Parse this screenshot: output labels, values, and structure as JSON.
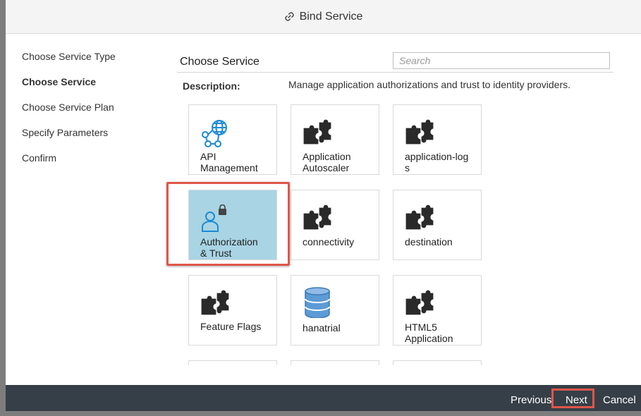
{
  "dialog": {
    "title": "Bind Service",
    "title_icon": "link-icon"
  },
  "steps": [
    {
      "label": "Choose Service Type",
      "active": false
    },
    {
      "label": "Choose Service",
      "active": true
    },
    {
      "label": "Choose Service Plan",
      "active": false
    },
    {
      "label": "Specify Parameters",
      "active": false
    },
    {
      "label": "Confirm",
      "active": false
    }
  ],
  "content": {
    "title": "Choose Service",
    "search": {
      "placeholder": "Search",
      "value": ""
    },
    "description_label": "Description:",
    "description_text": "Manage application authorizations and trust to identity providers."
  },
  "services": [
    {
      "label_lines": [
        "API",
        "Management"
      ],
      "icon": "api-management-icon",
      "selected": false
    },
    {
      "label_lines": [
        "Application",
        "Autoscaler"
      ],
      "icon": "puzzle-icon",
      "selected": false
    },
    {
      "label_lines": [
        "application-log",
        "s"
      ],
      "icon": "puzzle-icon",
      "selected": false
    },
    {
      "label_lines": [
        "Authorization",
        "& Trust"
      ],
      "icon": "user-lock-icon",
      "selected": true
    },
    {
      "label_lines": [
        "connectivity"
      ],
      "icon": "puzzle-icon",
      "selected": false
    },
    {
      "label_lines": [
        "destination"
      ],
      "icon": "puzzle-icon",
      "selected": false
    },
    {
      "label_lines": [
        "Feature Flags"
      ],
      "icon": "puzzle-icon",
      "selected": false
    },
    {
      "label_lines": [
        "hanatrial"
      ],
      "icon": "database-icon",
      "selected": false
    },
    {
      "label_lines": [
        "HTML5",
        "Application"
      ],
      "icon": "puzzle-icon",
      "selected": false
    }
  ],
  "footer": {
    "previous_label": "Previous",
    "next_label": "Next",
    "cancel_label": "Cancel"
  },
  "colors": {
    "selected_tile": "#a8d4e4",
    "highlight": "#e0564a",
    "footer_bg": "#363f47",
    "icon_blue": "#1c8ad6",
    "puzzle_dark": "#2a2a2a"
  }
}
